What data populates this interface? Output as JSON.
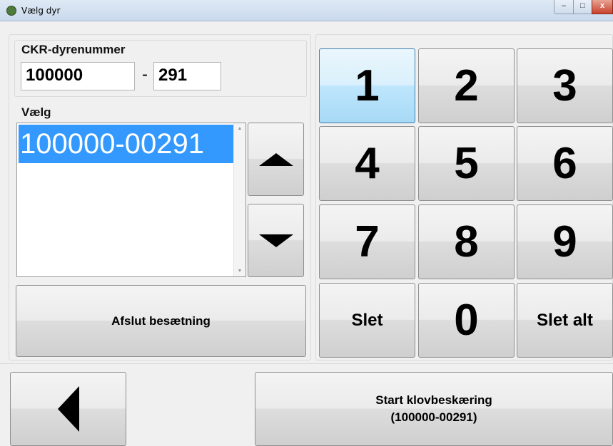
{
  "window": {
    "title": "Vælg dyr",
    "controls": {
      "minimize": "–",
      "maximize": "□",
      "close": "x"
    }
  },
  "ckr": {
    "label": "CKR-dyrenummer",
    "herd_value": "100000",
    "separator": "-",
    "animal_value": "291"
  },
  "select": {
    "label": "Vælg",
    "items": [
      "100000-00291"
    ],
    "selected_index": 0,
    "scroll_up": "▲",
    "scroll_down": "▼"
  },
  "nav": {
    "up_icon": "triangle-up-icon",
    "down_icon": "triangle-down-icon",
    "back_icon": "triangle-left-icon"
  },
  "actions": {
    "finish_label": "Afslut besætning",
    "start_label_line1": "Start klovbeskæring",
    "start_label_line2": "(100000-00291)"
  },
  "keypad": {
    "keys": [
      "1",
      "2",
      "3",
      "4",
      "5",
      "6",
      "7",
      "8",
      "9",
      "Slet",
      "0",
      "Slet alt"
    ],
    "focused_key": "1"
  },
  "colors": {
    "selection": "#3399ff",
    "background": "#f0f0f0"
  }
}
